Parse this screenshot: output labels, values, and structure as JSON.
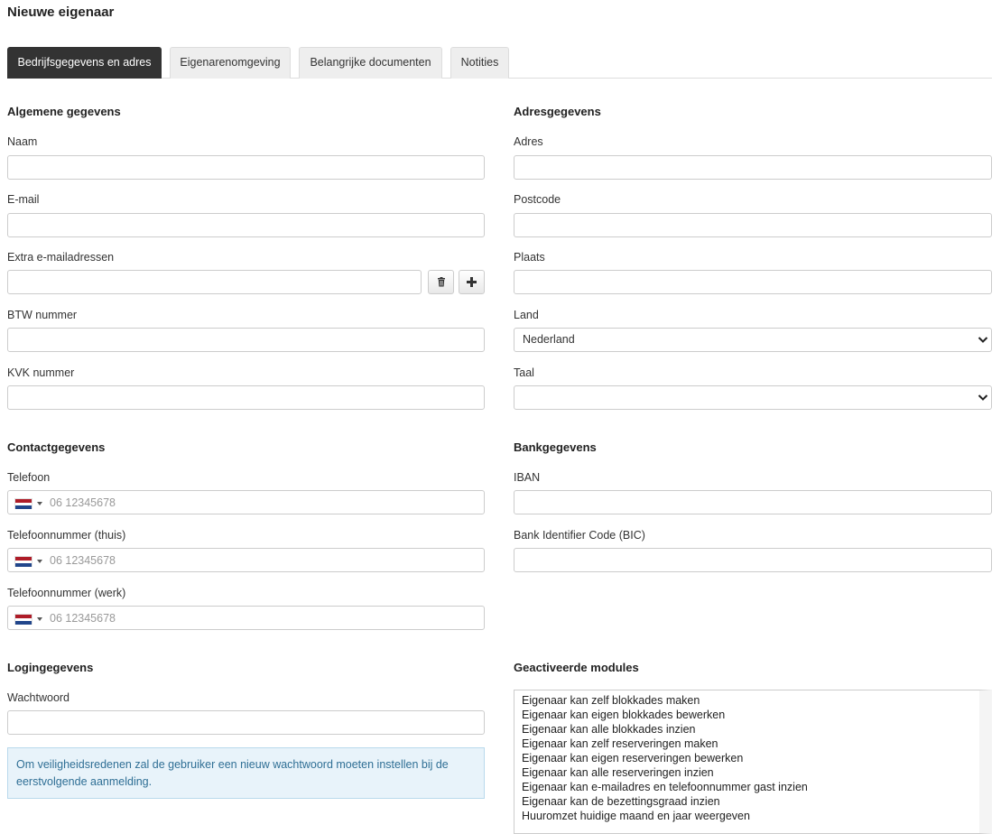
{
  "page": {
    "title": "Nieuwe eigenaar"
  },
  "tabs": [
    {
      "label": "Bedrijfsgegevens en adres",
      "active": true
    },
    {
      "label": "Eigenarenomgeving",
      "active": false
    },
    {
      "label": "Belangrijke documenten",
      "active": false
    },
    {
      "label": "Notities",
      "active": false
    }
  ],
  "general": {
    "heading": "Algemene gegevens",
    "name_label": "Naam",
    "name_value": "",
    "email_label": "E-mail",
    "email_value": "",
    "extra_email_label": "Extra e-mailadressen",
    "extra_email_value": "",
    "btw_label": "BTW nummer",
    "btw_value": "",
    "kvk_label": "KVK nummer",
    "kvk_value": ""
  },
  "address": {
    "heading": "Adresgegevens",
    "address_label": "Adres",
    "address_value": "",
    "postcode_label": "Postcode",
    "postcode_value": "",
    "city_label": "Plaats",
    "city_value": "",
    "country_label": "Land",
    "country_value": "Nederland",
    "language_label": "Taal",
    "language_value": ""
  },
  "contact": {
    "heading": "Contactgegevens",
    "phone_label": "Telefoon",
    "phone_home_label": "Telefoonnummer (thuis)",
    "phone_work_label": "Telefoonnummer (werk)",
    "phone_placeholder": "06 12345678"
  },
  "bank": {
    "heading": "Bankgegevens",
    "iban_label": "IBAN",
    "iban_value": "",
    "bic_label": "Bank Identifier Code (BIC)",
    "bic_value": ""
  },
  "login": {
    "heading": "Logingegevens",
    "password_label": "Wachtwoord",
    "password_value": "",
    "info_text": "Om veiligheidsredenen zal de gebruiker een nieuw wachtwoord moeten instellen bij de eerstvolgende aanmelding."
  },
  "modules": {
    "heading": "Geactiveerde modules",
    "items": [
      "Eigenaar kan zelf blokkades maken",
      "Eigenaar kan eigen blokkades bewerken",
      "Eigenaar kan alle blokkades inzien",
      "Eigenaar kan zelf reserveringen maken",
      "Eigenaar kan eigen reserveringen bewerken",
      "Eigenaar kan alle reserveringen inzien",
      "Eigenaar kan e-mailadres en telefoonnummer gast inzien",
      "Eigenaar kan de bezettingsgraad inzien",
      "Huuromzet huidige maand en jaar weergeven"
    ]
  },
  "icons": {
    "delete": "trash-icon",
    "add": "plus-icon",
    "flag": "flag-nl-icon",
    "select": "chevron-down-icon"
  }
}
